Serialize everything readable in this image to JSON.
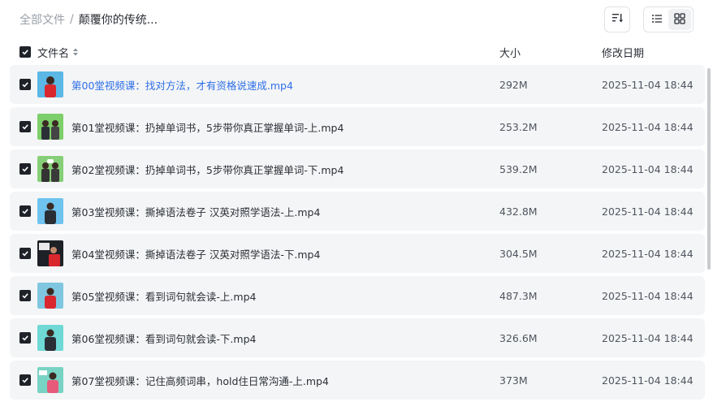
{
  "breadcrumb": {
    "root": "全部文件",
    "separator": "/",
    "current": "颠覆你的传统..."
  },
  "toolbar": {
    "sort_icon": "sort-icon",
    "list_view_icon": "list-view-icon",
    "grid_view_icon": "grid-view-icon"
  },
  "table_header": {
    "name": "文件名",
    "size": "大小",
    "date": "修改日期"
  },
  "colors": {
    "highlight_text": "#2e6fe8",
    "row_bg": "#f4f5f6",
    "checkbox": "#1f2329"
  },
  "files": [
    {
      "name": "第00堂视频课：找对方法，才有资格说速成.mp4",
      "size": "292M",
      "date": "2025-11-04 18:44",
      "checked": true,
      "highlighted": true
    },
    {
      "name": "第01堂视频课：扔掉单词书，5步带你真正掌握单词-上.mp4",
      "size": "253.2M",
      "date": "2025-11-04 18:44",
      "checked": true,
      "highlighted": false
    },
    {
      "name": "第02堂视频课：扔掉单词书，5步带你真正掌握单词-下.mp4",
      "size": "539.2M",
      "date": "2025-11-04 18:44",
      "checked": true,
      "highlighted": false
    },
    {
      "name": "第03堂视频课：撕掉语法卷子 汉英对照学语法-上.mp4",
      "size": "432.8M",
      "date": "2025-11-04 18:44",
      "checked": true,
      "highlighted": false
    },
    {
      "name": "第04堂视频课：撕掉语法卷子 汉英对照学语法-下.mp4",
      "size": "304.5M",
      "date": "2025-11-04 18:44",
      "checked": true,
      "highlighted": false
    },
    {
      "name": "第05堂视频课：看到词句就会读-上.mp4",
      "size": "487.3M",
      "date": "2025-11-04 18:44",
      "checked": true,
      "highlighted": false
    },
    {
      "name": "第06堂视频课：看到词句就会读-下.mp4",
      "size": "326.6M",
      "date": "2025-11-04 18:44",
      "checked": true,
      "highlighted": false
    },
    {
      "name": "第07堂视频课：记住高频词串，hold住日常沟通-上.mp4",
      "size": "373M",
      "date": "2025-11-04 18:44",
      "checked": true,
      "highlighted": false
    }
  ]
}
